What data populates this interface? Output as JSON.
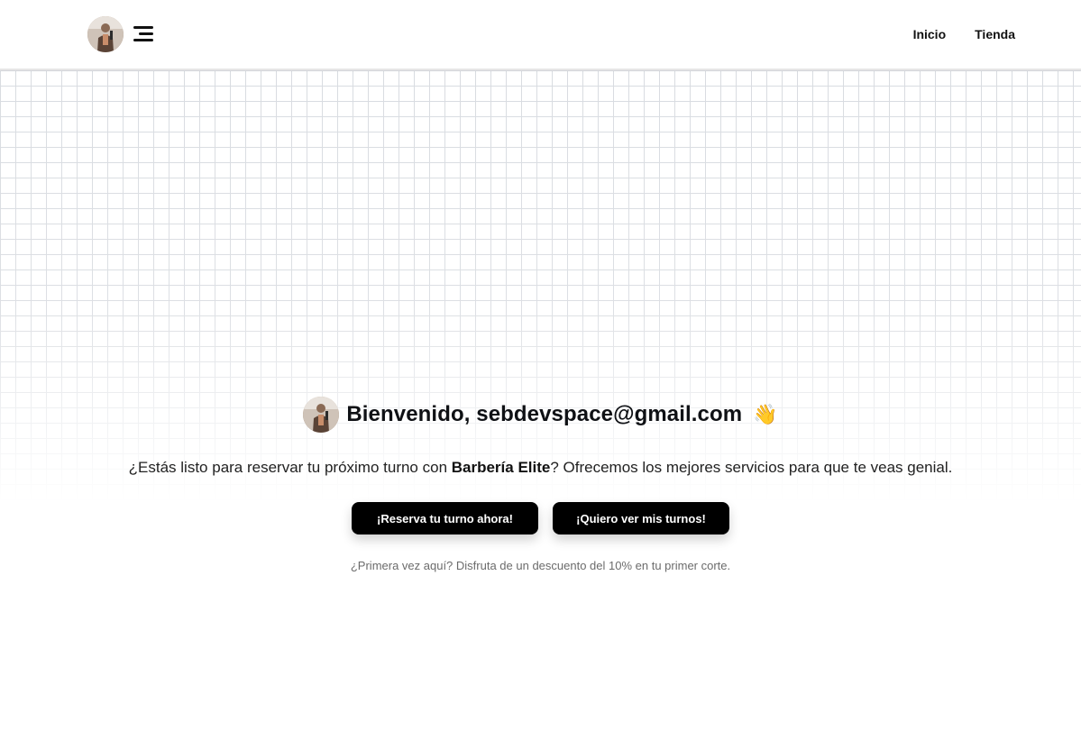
{
  "header": {
    "avatar_icon": "user-avatar-photo",
    "menu_icon": "hamburger-menu-icon",
    "nav": [
      {
        "label": "Inicio"
      },
      {
        "label": "Tienda"
      }
    ]
  },
  "hero": {
    "greeting": "Bienvenido, sebdevspace@gmail.com",
    "wave": "👋",
    "subtitle_prefix": "¿Estás listo para reservar tu próximo turno con ",
    "brand": "Barbería Elite",
    "subtitle_suffix": "? Ofrecemos los mejores servicios para que te veas genial.",
    "primary_button": "¡Reserva tu turno ahora!",
    "secondary_button": "¡Quiero ver mis turnos!",
    "note": "¿Primera vez aquí? Disfruta de un descuento del 10% en tu primer corte."
  },
  "colors": {
    "button_bg": "#000000",
    "button_text": "#ffffff",
    "grid_line": "#d9dce1",
    "note_text": "#6b6b6b"
  }
}
